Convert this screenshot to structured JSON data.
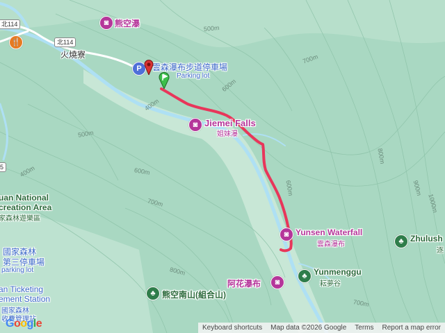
{
  "map": {
    "colors": {
      "terrain": "#a9d8c2",
      "valley": "#c8e7d6",
      "river": "#aee0f4",
      "route": "#e8365a",
      "poi": "#b5369a",
      "park": "#2f7d4a",
      "parking": "#4f6fd8"
    },
    "labels": {
      "xiongkong_falls": "熊空瀑",
      "huoshaoliao": "火燒寮",
      "road_114": "北114",
      "road_114_left": "北114",
      "parking_cn": "雲森瀑布步道停車場",
      "parking_en": "Parking lot",
      "jiemei_en": "Jiemei Falls",
      "jiemei_cn": "姐妹瀑",
      "yunsen_en": "Yunsen Waterfall",
      "yunsen_cn": "雲森瀑布",
      "zhulush_en": "Zhulush",
      "zhulush_cn": "逐",
      "yunmenggu_en": "Yunmenggu",
      "yunmenggu_cn": "耘夢谷",
      "ahua_cn": "阿花瀑布",
      "xiongkong_south": "熊空南山(組合山)",
      "rec_area_1": "uan National",
      "rec_area_2": "creation Area",
      "rec_area_3": "家森林遊樂區",
      "left_lot_1": "國家森林",
      "left_lot_2": "第三停車場",
      "left_lot_3": "parking lot",
      "ticket_1": "an Ticketing",
      "ticket_2": "ement Station",
      "ticket_3": "國家森林",
      "ticket_4": "收費管理站",
      "left_road": "5"
    },
    "contours": [
      "500m",
      "600m",
      "400m",
      "500m",
      "400m",
      "600m",
      "700m",
      "600m",
      "700m",
      "800m",
      "800m",
      "900m",
      "1000m",
      "700m"
    ]
  },
  "footer": {
    "shortcuts": "Keyboard shortcuts",
    "map_data": "Map data ©2026 Google",
    "terms": "Terms",
    "report": "Report a map error"
  },
  "logo": "Google",
  "icons": {
    "poi": "camera-pin-icon",
    "park": "park-pin-icon",
    "parking": "parking-pin-icon",
    "restaurant": "restaurant-pin-icon",
    "start": "start-flag-icon",
    "end": "end-marker-icon"
  }
}
